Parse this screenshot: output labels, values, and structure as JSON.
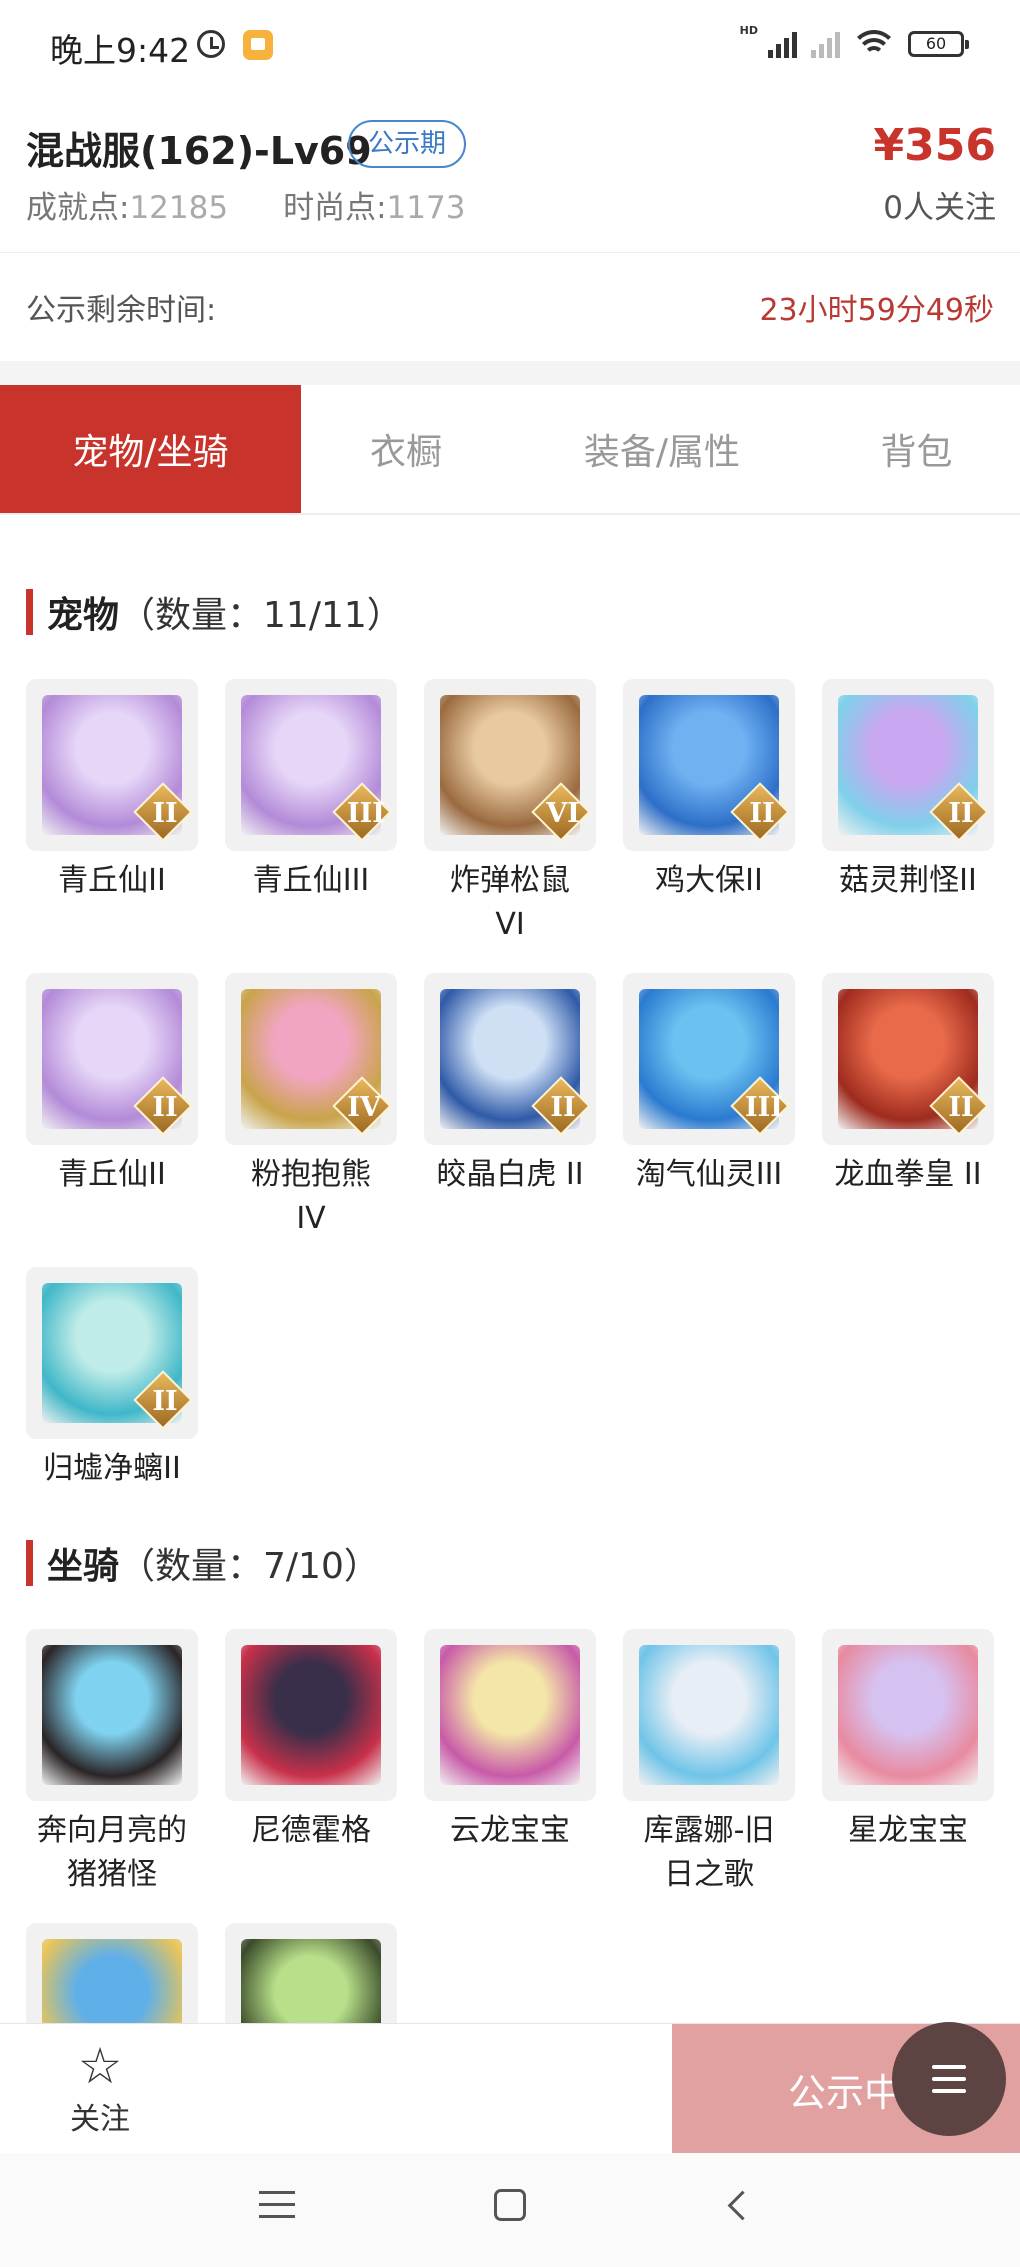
{
  "status_bar": {
    "time": "晚上9:42",
    "hd": "HD",
    "battery": "60"
  },
  "header": {
    "title": "混战服(162)-Lv69",
    "badge": "公示期",
    "price": "¥356",
    "achievement_label": "成就点:",
    "achievement_value": "12185",
    "fashion_label": "时尚点:",
    "fashion_value": "1173",
    "followers": "0人关注"
  },
  "countdown": {
    "label": "公示剩余时间:",
    "value": "23小时59分49秒"
  },
  "tabs": [
    {
      "label": "宠物/坐骑",
      "active": true
    },
    {
      "label": "衣橱"
    },
    {
      "label": "装备/属性"
    },
    {
      "label": "背包"
    }
  ],
  "pets": {
    "title": "宠物",
    "count_text": "（数量：11/11）",
    "items": [
      {
        "name": "青丘仙II",
        "rank": "II",
        "colors": [
          "#e6d6f7",
          "#b38ad8"
        ]
      },
      {
        "name": "青丘仙III",
        "rank": "III",
        "colors": [
          "#e6d6f7",
          "#b38ad8"
        ]
      },
      {
        "name": "炸弹松鼠\nVI",
        "rank": "VI",
        "colors": [
          "#e8c9a0",
          "#9a6a3f"
        ]
      },
      {
        "name": "鸡大保II",
        "rank": "II",
        "colors": [
          "#6fb2f2",
          "#2d6fc8"
        ]
      },
      {
        "name": "菇灵荆怪II",
        "rank": "II",
        "colors": [
          "#c9a6f0",
          "#7fd0ea"
        ]
      },
      {
        "name": "青丘仙II",
        "rank": "II",
        "colors": [
          "#e6d6f7",
          "#b38ad8"
        ]
      },
      {
        "name": "粉抱抱熊\nIV",
        "rank": "IV",
        "colors": [
          "#f2a5c3",
          "#c9a44a"
        ]
      },
      {
        "name": "皎晶白虎 II",
        "rank": "II",
        "colors": [
          "#cfe0f5",
          "#2f5aa8"
        ]
      },
      {
        "name": "淘气仙灵III",
        "rank": "III",
        "colors": [
          "#6bc1f0",
          "#2a7ad0"
        ]
      },
      {
        "name": "龙血拳皇 II",
        "rank": "II",
        "colors": [
          "#e86a4a",
          "#9e2b1e"
        ]
      },
      {
        "name": "归墟净螭II",
        "rank": "II",
        "colors": [
          "#bfece8",
          "#3fb7c8"
        ]
      }
    ]
  },
  "mounts": {
    "title": "坐骑",
    "count_text": "（数量：7/10）",
    "items": [
      {
        "name": "奔向月亮的\n猪猪怪",
        "colors": [
          "#7fd3f0",
          "#2a2426"
        ]
      },
      {
        "name": "尼德霍格",
        "colors": [
          "#3a2f4a",
          "#c8304a"
        ]
      },
      {
        "name": "云龙宝宝",
        "colors": [
          "#f4e6a8",
          "#c85aa8"
        ]
      },
      {
        "name": "库露娜-旧\n日之歌",
        "colors": [
          "#e8eef5",
          "#6fc4e8"
        ]
      },
      {
        "name": "星龙宝宝",
        "colors": [
          "#d6c2f0",
          "#e88aa0"
        ]
      },
      {
        "name": "",
        "colors": [
          "#5fb0e8",
          "#e8c45a"
        ]
      },
      {
        "name": "",
        "colors": [
          "#b8e08a",
          "#3a4a2a"
        ]
      }
    ]
  },
  "bottom_bar": {
    "follow_label": "关注",
    "action_label": "公示中"
  }
}
